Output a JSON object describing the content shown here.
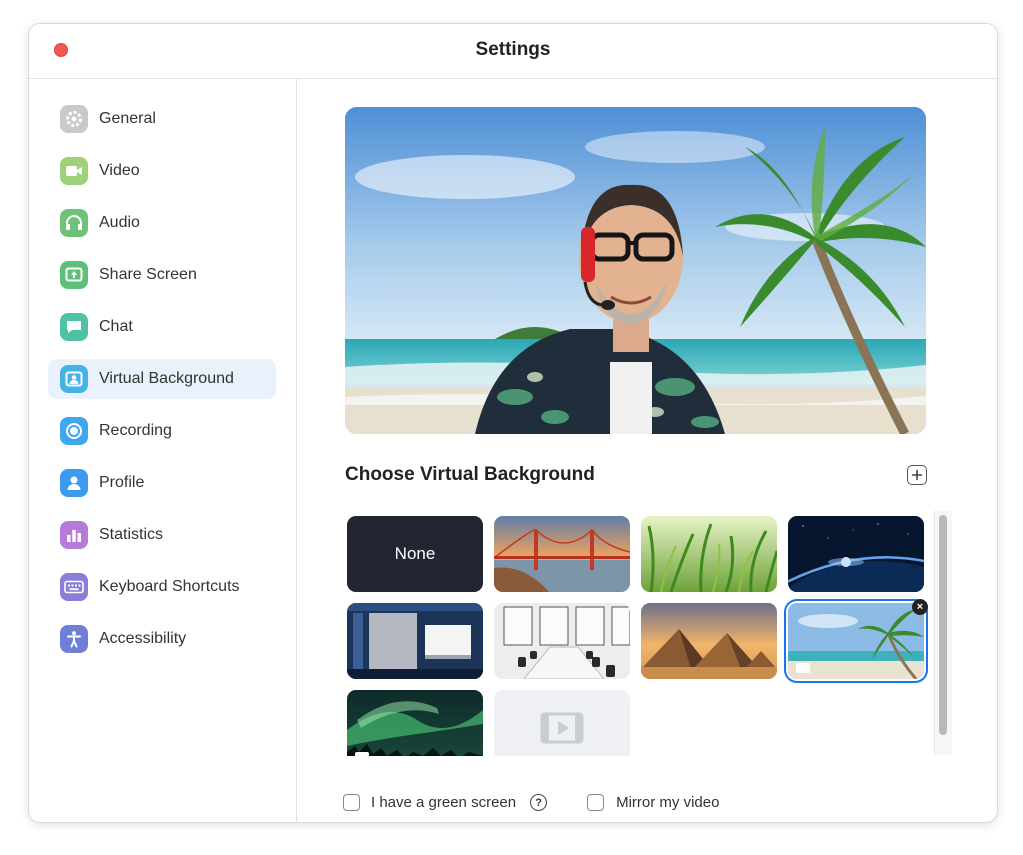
{
  "window": {
    "title": "Settings"
  },
  "sidebar": {
    "items": [
      {
        "label": "General",
        "icon": "gear-icon",
        "color": "#c9c9c9",
        "active": false
      },
      {
        "label": "Video",
        "icon": "video-camera-icon",
        "color": "#9fd17a",
        "active": false
      },
      {
        "label": "Audio",
        "icon": "headphones-icon",
        "color": "#6fc27a",
        "active": false
      },
      {
        "label": "Share Screen",
        "icon": "share-screen-icon",
        "color": "#5dbf7a",
        "active": false
      },
      {
        "label": "Chat",
        "icon": "chat-bubble-icon",
        "color": "#4fc1a6",
        "active": false
      },
      {
        "label": "Virtual Background",
        "icon": "virtual-background-icon",
        "color": "#46b3e6",
        "active": true
      },
      {
        "label": "Recording",
        "icon": "record-icon",
        "color": "#3fa7ef",
        "active": false
      },
      {
        "label": "Profile",
        "icon": "person-icon",
        "color": "#3d9bef",
        "active": false
      },
      {
        "label": "Statistics",
        "icon": "bar-chart-icon",
        "color": "#b67ad8",
        "active": false
      },
      {
        "label": "Keyboard Shortcuts",
        "icon": "keyboard-icon",
        "color": "#8a7fd6",
        "active": false
      },
      {
        "label": "Accessibility",
        "icon": "accessibility-icon",
        "color": "#6f7fd6",
        "active": false
      }
    ]
  },
  "main": {
    "section_title": "Choose Virtual Background",
    "add_button_icon": "plus-square-icon",
    "backgrounds": [
      {
        "label": "None",
        "kind": "none"
      },
      {
        "kind": "golden-gate-bridge"
      },
      {
        "kind": "grass"
      },
      {
        "kind": "earth-from-space"
      },
      {
        "kind": "stage"
      },
      {
        "kind": "conference-room"
      },
      {
        "kind": "pyramids"
      },
      {
        "kind": "beach-palm",
        "selected": true,
        "video": true
      },
      {
        "kind": "aurora",
        "video": true
      },
      {
        "kind": "video-placeholder"
      }
    ],
    "green_screen_label": "I have a green screen",
    "green_screen_checked": false,
    "mirror_label": "Mirror my video",
    "mirror_checked": false
  },
  "colors": {
    "accent": "#1b73e8",
    "active_item_bg": "#e8f1fc",
    "close_button": "#f0594f"
  }
}
